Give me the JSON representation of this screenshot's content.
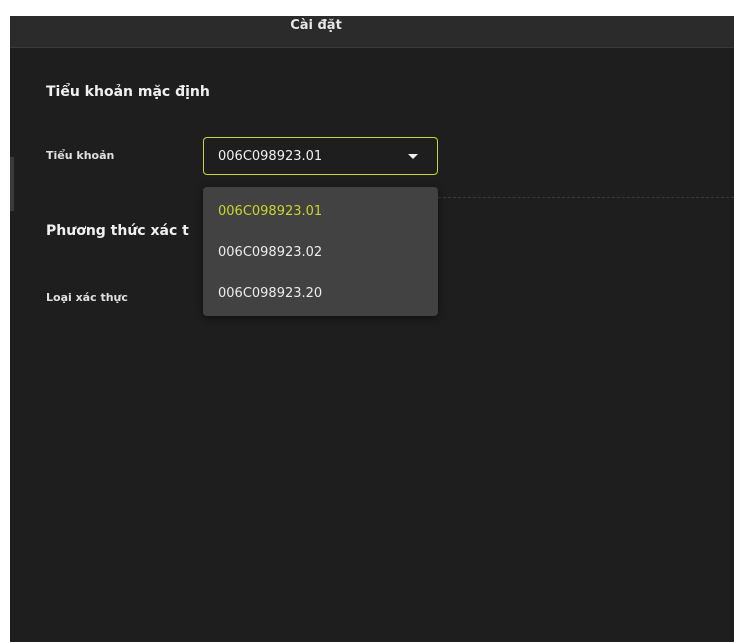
{
  "dialog": {
    "title": "Cài đặt"
  },
  "default_subaccount_section": {
    "title": "Tiểu khoản mặc định",
    "field_label": "Tiểu khoản",
    "selected_value": "006C098923.01",
    "options": [
      {
        "label": "006C098923.01",
        "selected": true
      },
      {
        "label": "006C098923.02",
        "selected": false
      },
      {
        "label": "006C098923.20",
        "selected": false
      }
    ]
  },
  "auth_method_section": {
    "title": "Phương thức xác t",
    "field_label": "Loại xác thực"
  },
  "colors": {
    "accent": "#c8d72a",
    "background": "#1e1e1e",
    "dropdown_background": "#424242"
  },
  "icons": {
    "select_caret": "caret-down-icon"
  }
}
